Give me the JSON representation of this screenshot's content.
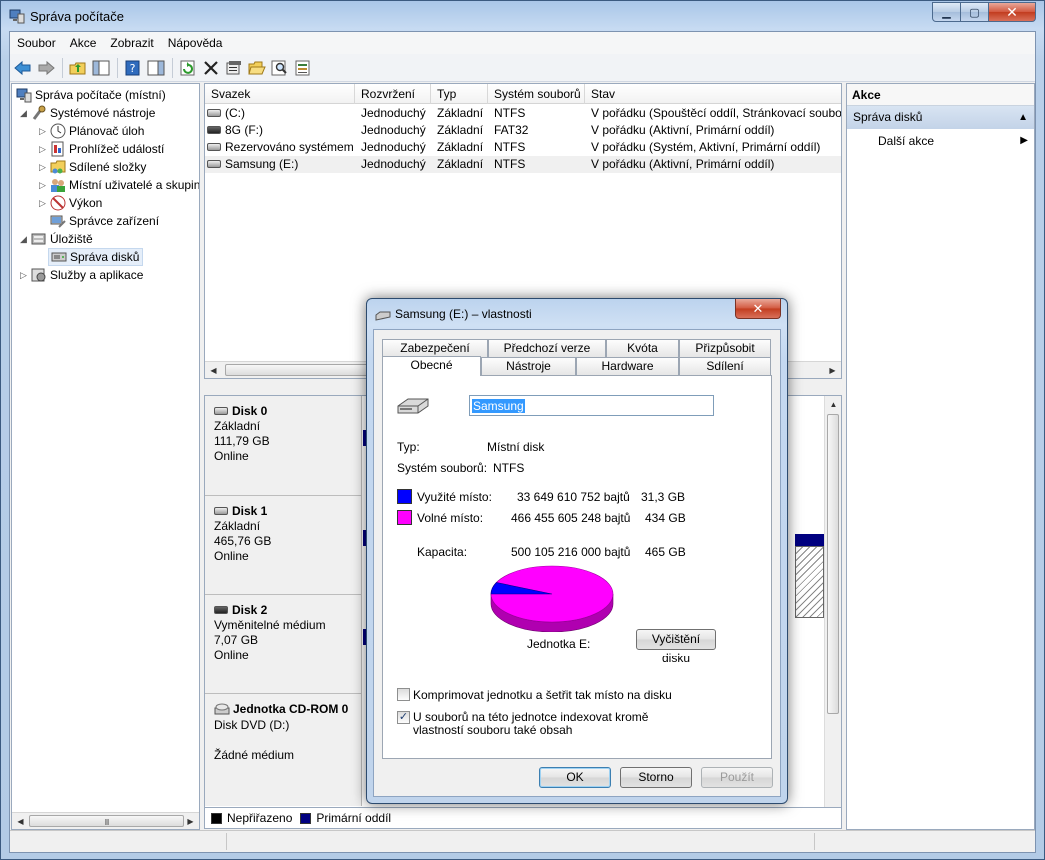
{
  "window": {
    "title": "Správa počítače",
    "controls": {
      "minimize": "▁",
      "maximize": "▢",
      "close": "✕"
    }
  },
  "menu": [
    "Soubor",
    "Akce",
    "Zobrazit",
    "Nápověda"
  ],
  "toolbar_icons": [
    "back-arrow-icon",
    "forward-arrow-icon",
    "up-folder-icon",
    "show-hide-tree-icon",
    "help-icon",
    "show-hide-action-pane-icon",
    "refresh-icon",
    "delete-icon",
    "properties-icon",
    "open-folder-icon",
    "search-icon",
    "export-icon"
  ],
  "tree": {
    "root": "Správa počítače (místní)",
    "system_tools": "Systémové nástroje",
    "items": [
      "Plánovač úloh",
      "Prohlížeč událostí",
      "Sdílené složky",
      "Místní uživatelé a skupiny",
      "Výkon",
      "Správce zařízení"
    ],
    "storage": "Úložiště",
    "disk_mgmt": "Správa disků",
    "services": "Služby a aplikace",
    "scroll_grip": "III"
  },
  "volumes": {
    "columns": [
      "Svazek",
      "Rozvržení",
      "Typ",
      "Systém souborů",
      "Stav"
    ],
    "rows": [
      {
        "name": "(C:)",
        "layout": "Jednoduchý",
        "type": "Základní",
        "fs": "NTFS",
        "status": "V pořádku (Spouštěcí oddíl, Stránkovací soubor, Výpis paměti, Primární oddíl)"
      },
      {
        "name": "8G (F:)",
        "layout": "Jednoduchý",
        "type": "Základní",
        "fs": "FAT32",
        "status": "V pořádku (Aktivní, Primární oddíl)"
      },
      {
        "name": "Rezervováno systémem",
        "layout": "Jednoduchý",
        "type": "Základní",
        "fs": "NTFS",
        "status": "V pořádku (Systém, Aktivní, Primární oddíl)"
      },
      {
        "name": "Samsung (E:)",
        "layout": "Jednoduchý",
        "type": "Základní",
        "fs": "NTFS",
        "status": "V pořádku (Aktivní, Primární oddíl)"
      }
    ]
  },
  "disks": [
    {
      "name": "Disk 0",
      "l1": "Základní",
      "l2": "111,79 GB",
      "l3": "Online"
    },
    {
      "name": "Disk 1",
      "l1": "Základní",
      "l2": "465,76 GB",
      "l3": "Online"
    },
    {
      "name": "Disk 2",
      "l1": "Vyměnitelné médium",
      "l2": "7,07 GB",
      "l3": "Online"
    },
    {
      "name": "Jednotka CD-ROM 0",
      "l1": "Disk DVD (D:)",
      "l2": "",
      "l3": "Žádné médium"
    }
  ],
  "legend": {
    "unallocated": "Nepřiřazeno",
    "primary": "Primární oddíl",
    "unallocated_color": "#000000",
    "primary_color": "#000080"
  },
  "actions": {
    "header": "Akce",
    "section": "Správa disků",
    "more": "Další akce"
  },
  "dialog": {
    "title": "Samsung (E:) – vlastnosti",
    "close": "✕",
    "tabs_top": [
      "Zabezpečení",
      "Předchozí verze",
      "Kvóta",
      "Přizpůsobit"
    ],
    "tabs_bottom": [
      "Obecné",
      "Nástroje",
      "Hardware",
      "Sdílení"
    ],
    "name_value": "Samsung",
    "type_label": "Typ:",
    "type_value": "Místní disk",
    "fs_label": "Systém souborů:",
    "fs_value": "NTFS",
    "used_label": "Využité místo:",
    "used_bytes": "33 649 610 752 bajtů",
    "used_gb": "31,3 GB",
    "used_color": "#0000ff",
    "free_label": "Volné místo:",
    "free_bytes": "466 455 605 248 bajtů",
    "free_gb": "434 GB",
    "free_color": "#ff00ff",
    "cap_label": "Kapacita:",
    "cap_bytes": "500 105 216 000 bajtů",
    "cap_gb": "465 GB",
    "used_fraction": 0.0673,
    "drive_label": "Jednotka E:",
    "cleanup": "Vyčištění disku",
    "compress": "Komprimovat jednotku a šetřit tak místo na disku",
    "compress_checked": false,
    "index": "U souborů na této jednotce indexovat kromě vlastností souboru také obsah",
    "index_checked": true,
    "check_mark": "✓",
    "ok": "OK",
    "cancel": "Storno",
    "apply": "Použít"
  }
}
